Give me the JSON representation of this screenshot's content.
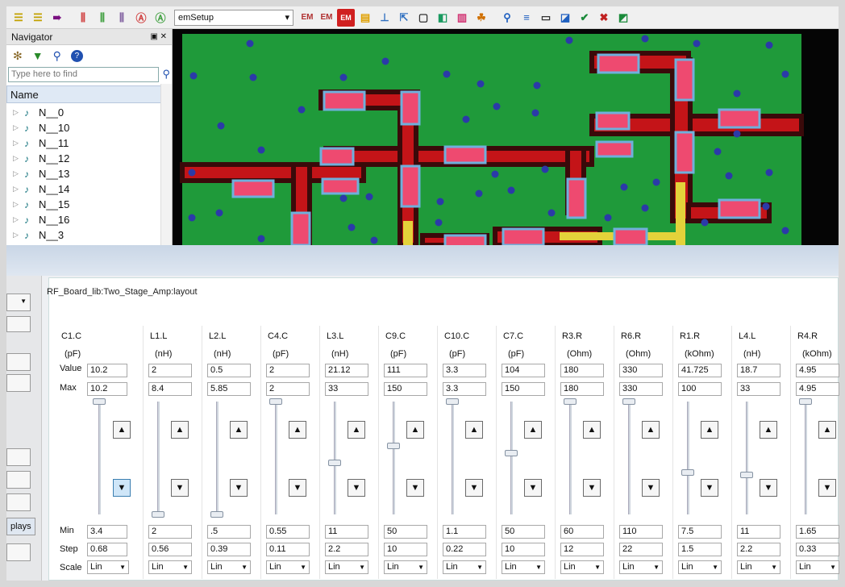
{
  "toolbar": {
    "design_combo": "emSetup",
    "left_icons": [
      "align-icon",
      "align-icon",
      "goto-icon",
      "bus-icon",
      "bus-icon",
      "bus-icon",
      "auto-route-icon",
      "auto-route-icon"
    ],
    "right_icons": [
      "em-setup-icon",
      "em-clear-icon",
      "em-icon",
      "chart-icon",
      "probe-icon",
      "export-icon",
      "3d-view-icon",
      "3d-render-icon",
      "color-layers-icon",
      "tune-icon",
      "search-icon",
      "list-icon",
      "rect-icon",
      "plot-icon",
      "check-icon",
      "bug-icon",
      "mark-icon"
    ]
  },
  "navigator": {
    "title": "Navigator",
    "float_glyph": "▣",
    "close_glyph": "✕",
    "search_placeholder": "Type here to find",
    "column_header": "Name",
    "nets": [
      "N__0",
      "N__10",
      "N__11",
      "N__12",
      "N__13",
      "N__14",
      "N__15",
      "N__16",
      "N__3"
    ]
  },
  "layout_path": "RF_Board_lib:Two_Stage_Amp:layout",
  "row_labels": {
    "value": "Value",
    "max": "Max",
    "min": "Min",
    "step": "Step",
    "scale": "Scale"
  },
  "displays_label": "plays",
  "params": [
    {
      "name": "C1.C",
      "unit": "(pF)",
      "value": "10.2",
      "max": "10.2",
      "min": "3.4",
      "step": "0.68",
      "scale": "Lin",
      "slider": 0.0
    },
    {
      "name": "L1.L",
      "unit": "(nH)",
      "value": "2",
      "max": "8.4",
      "min": "2",
      "step": "0.56",
      "scale": "Lin",
      "slider": 1.0
    },
    {
      "name": "L2.L",
      "unit": "(nH)",
      "value": "0.5",
      "max": "5.85",
      "min": ".5",
      "step": "0.39",
      "scale": "Lin",
      "slider": 1.0
    },
    {
      "name": "C4.C",
      "unit": "(pF)",
      "value": "2",
      "max": "2",
      "min": "0.55",
      "step": "0.11",
      "scale": "Lin",
      "slider": 0.0
    },
    {
      "name": "L3.L",
      "unit": "(nH)",
      "value": "21.12",
      "max": "33",
      "min": "11",
      "step": "2.2",
      "scale": "Lin",
      "slider": 0.54
    },
    {
      "name": "C9.C",
      "unit": "(pF)",
      "value": "111",
      "max": "150",
      "min": "50",
      "step": "10",
      "scale": "Lin",
      "slider": 0.39
    },
    {
      "name": "C10.C",
      "unit": "(pF)",
      "value": "3.3",
      "max": "3.3",
      "min": "1.1",
      "step": "0.22",
      "scale": "Lin",
      "slider": 0.0
    },
    {
      "name": "C7.C",
      "unit": "(pF)",
      "value": "104",
      "max": "150",
      "min": "50",
      "step": "10",
      "scale": "Lin",
      "slider": 0.46
    },
    {
      "name": "R3.R",
      "unit": "(Ohm)",
      "value": "180",
      "max": "180",
      "min": "60",
      "step": "12",
      "scale": "Lin",
      "slider": 0.0
    },
    {
      "name": "R6.R",
      "unit": "(Ohm)",
      "value": "330",
      "max": "330",
      "min": "110",
      "step": "22",
      "scale": "Lin",
      "slider": 0.0
    },
    {
      "name": "R1.R",
      "unit": "(kOhm)",
      "value": "41.725",
      "max": "100",
      "min": "7.5",
      "step": "1.5",
      "scale": "Lin",
      "slider": 0.63
    },
    {
      "name": "L4.L",
      "unit": "(nH)",
      "value": "18.7",
      "max": "33",
      "min": "11",
      "step": "2.2",
      "scale": "Lin",
      "slider": 0.65
    },
    {
      "name": "R4.R",
      "unit": "(kOhm)",
      "value": "4.95",
      "max": "4.95",
      "min": "1.65",
      "step": "0.33",
      "scale": "Lin",
      "slider": 0.0
    }
  ],
  "colors": {
    "board": "#1f9a3a",
    "trace": "#c41418",
    "via": "#2b3aa8",
    "yellow": "#e3d23a",
    "pad": "#6fb0dc",
    "background": "#050505"
  }
}
